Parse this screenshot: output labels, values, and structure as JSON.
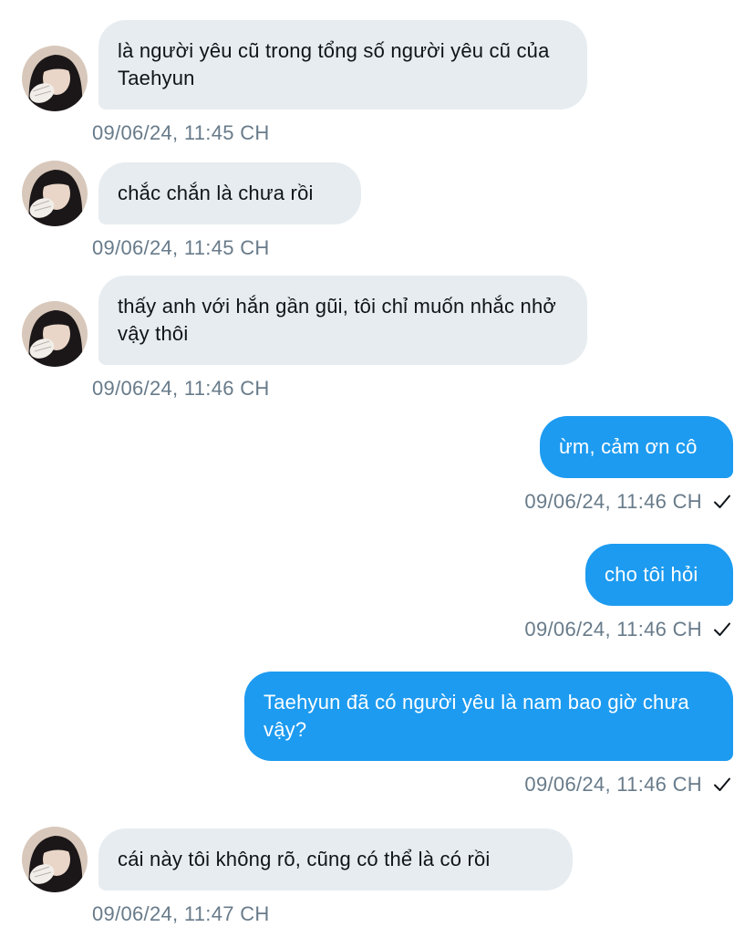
{
  "colors": {
    "incoming_bubble": "#e7ecf0",
    "outgoing_bubble": "#1d9bf0",
    "timestamp": "#687b8a",
    "text_dark": "#0f1419"
  },
  "messages": [
    {
      "side": "in",
      "text": "là người yêu cũ trong tổng số người yêu cũ của Taehyun",
      "time": "09/06/24, 11:45 CH"
    },
    {
      "side": "in",
      "text": "chắc chắn là chưa rồi",
      "time": "09/06/24, 11:45 CH"
    },
    {
      "side": "in",
      "text": "thấy anh với hắn gần gũi, tôi chỉ muốn nhắc nhở vậy thôi",
      "time": "09/06/24, 11:46 CH"
    },
    {
      "side": "out",
      "text": "ừm, cảm ơn cô",
      "time": "09/06/24, 11:46 CH",
      "status_icon": "check-icon"
    },
    {
      "side": "out",
      "text": "cho tôi hỏi",
      "time": "09/06/24, 11:46 CH",
      "status_icon": "check-icon"
    },
    {
      "side": "out",
      "text": "Taehyun đã có người yêu là nam bao giờ chưa vậy?",
      "time": "09/06/24, 11:46 CH",
      "status_icon": "check-icon"
    },
    {
      "side": "in",
      "text": "cái này tôi không rõ, cũng có thể là có rồi",
      "time": "09/06/24, 11:47 CH"
    }
  ]
}
